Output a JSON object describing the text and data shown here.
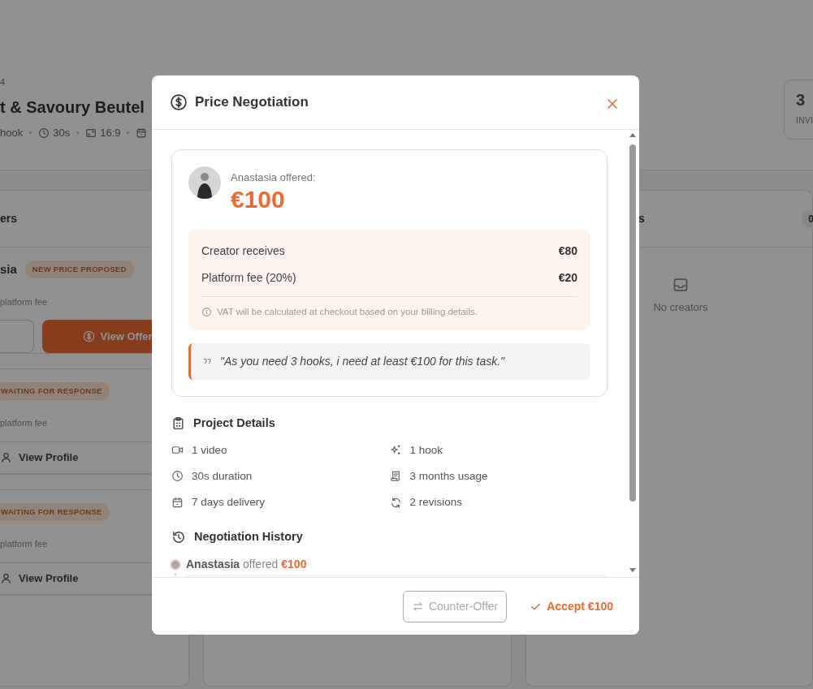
{
  "background_page": {
    "breadcrumb": "4",
    "title": "t & Savoury Beutel",
    "meta": [
      {
        "kind": "text",
        "text": "hook"
      },
      {
        "kind": "clock",
        "text": "30s"
      },
      {
        "kind": "ratio",
        "text": "16:9"
      },
      {
        "kind": "calendar"
      }
    ],
    "stat_card": {
      "value": "3",
      "label": "INVI"
    },
    "columns": [
      {
        "title": "ers",
        "cards": [
          {
            "name": "sia",
            "status": "NEW PRICE PROPOSED",
            "note": "platform fee",
            "actions": [
              {
                "kind": "outline"
              },
              {
                "kind": "offer",
                "label": "View Offer"
              }
            ]
          },
          {
            "status": "WAITING FOR RESPONSE",
            "note": "platform fee",
            "actions": [
              {
                "kind": "profile",
                "label": "View Profile"
              }
            ]
          },
          {
            "status": "WAITING FOR RESPONSE",
            "note": "platform fee",
            "actions": [
              {
                "kind": "profile",
                "label": "View Profile"
              }
            ]
          }
        ]
      },
      {},
      {
        "title": "s",
        "count": "0",
        "empty_text": "No creators"
      }
    ]
  },
  "modal": {
    "title": "Price Negotiation",
    "offer": {
      "intro": "Anastasia offered:",
      "amount": "€100",
      "breakdown": [
        {
          "label": "Creator receives",
          "value": "€80"
        },
        {
          "label": "Platform fee (20%)",
          "value": "€20"
        }
      ],
      "vat_note": "VAT will be calculated at checkout based on your billing details.",
      "message": "\"As you need 3 hooks, i need at least €100 for this task.\""
    },
    "project_details": {
      "title": "Project Details",
      "items": [
        {
          "kind": "video",
          "text": "1 video"
        },
        {
          "kind": "sparkle",
          "text": "1 hook"
        },
        {
          "kind": "clock",
          "text": "30s duration"
        },
        {
          "kind": "license",
          "text": "3 months usage"
        },
        {
          "kind": "calendar",
          "text": "7 days delivery"
        },
        {
          "kind": "refresh",
          "text": "2 revisions"
        }
      ]
    },
    "history": {
      "title": "Negotiation History",
      "entries": [
        {
          "name": "Anastasia",
          "verb": "offered",
          "amount": "€100"
        }
      ]
    },
    "buttons": [
      {
        "kind": "counter",
        "label": "Counter-Offer",
        "disabled": true
      },
      {
        "kind": "accept",
        "label": "Accept €100",
        "disabled": false
      }
    ]
  }
}
